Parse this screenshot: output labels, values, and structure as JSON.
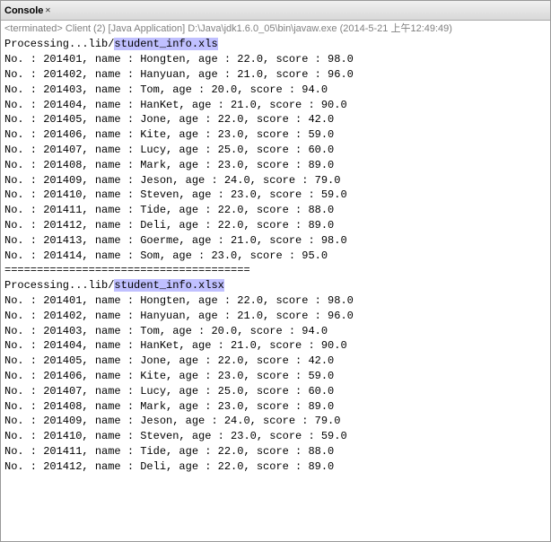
{
  "window": {
    "title": "Console",
    "close_label": "✕"
  },
  "terminated_line": "<terminated> Client (2) [Java Application] D:\\Java\\jdk1.6.0_05\\bin\\javaw.exe (2014-5-21 上午12:49:49)",
  "sections": [
    {
      "processing": "Processing...lib/student_info.xls",
      "highlight": "student_info.xls",
      "records": [
        "No. : 201401, name : Hongten, age : 22.0, score : 98.0",
        "No. : 201402, name : Hanyuan, age : 21.0, score : 96.0",
        "No. : 201403, name : Tom, age : 20.0, score : 94.0",
        "No. : 201404, name : HanKet, age : 21.0, score : 90.0",
        "No. : 201405, name : Jone, age : 22.0, score : 42.0",
        "No. : 201406, name : Kite, age : 23.0, score : 59.0",
        "No. : 201407, name : Lucy, age : 25.0, score : 60.0",
        "No. : 201408, name : Mark, age : 23.0, score : 89.0",
        "No. : 201409, name : Jeson, age : 24.0, score : 79.0",
        "No. : 201410, name : Steven, age : 23.0, score : 59.0",
        "No. : 201411, name : Tide, age : 22.0, score : 88.0",
        "No. : 201412, name : Deli, age : 22.0, score : 89.0",
        "No. : 201413, name : Goerme, age : 21.0, score : 98.0",
        "No. : 201414, name : Som, age : 23.0, score : 95.0"
      ],
      "separator": "======================================"
    },
    {
      "processing": "Processing...lib/student_info.xlsx",
      "highlight": "student_info.xlsx",
      "records": [
        "No. : 201401, name : Hongten, age : 22.0, score : 98.0",
        "No. : 201402, name : Hanyuan, age : 21.0, score : 96.0",
        "No. : 201403, name : Tom, age : 20.0, score : 94.0",
        "No. : 201404, name : HanKet, age : 21.0, score : 90.0",
        "No. : 201405, name : Jone, age : 22.0, score : 42.0",
        "No. : 201406, name : Kite, age : 23.0, score : 59.0",
        "No. : 201407, name : Lucy, age : 25.0, score : 60.0",
        "No. : 201408, name : Mark, age : 23.0, score : 89.0",
        "No. : 201409, name : Jeson, age : 24.0, score : 79.0",
        "No. : 201410, name : Steven, age : 23.0, score : 59.0",
        "No. : 201411, name : Tide, age : 22.0, score : 88.0",
        "No. : 201412, name : Deli, age : 22.0, score : 89.0"
      ]
    }
  ]
}
